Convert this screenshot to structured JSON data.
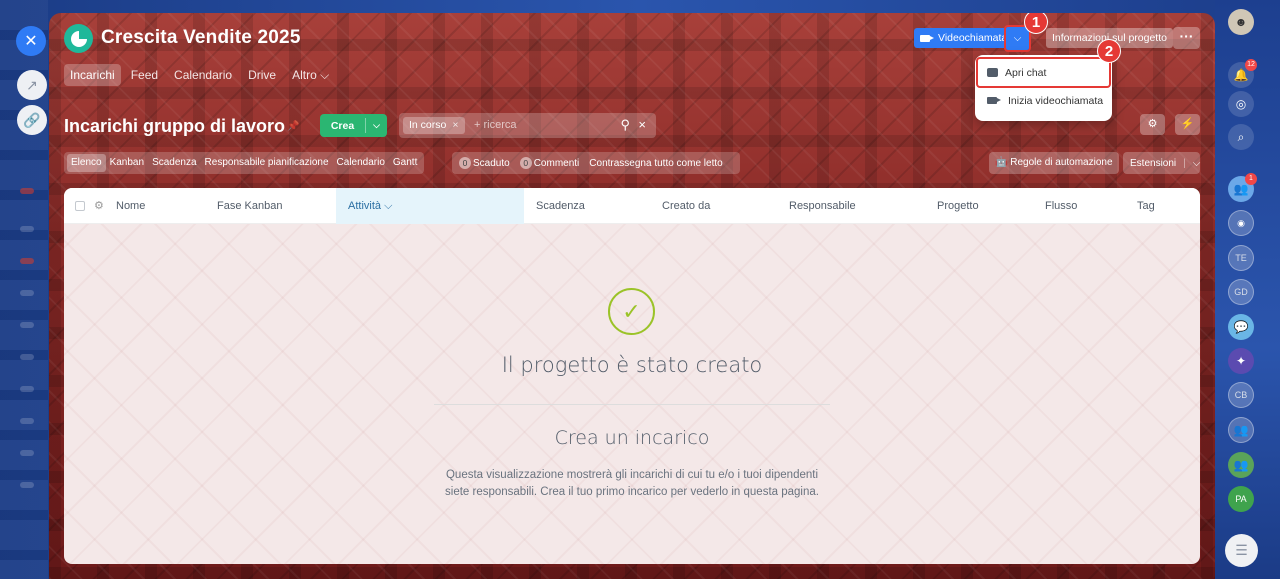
{
  "project": {
    "title": "Crescita Vendite 2025"
  },
  "topnav": {
    "tabs": [
      "Incarichi",
      "Feed",
      "Calendario",
      "Drive",
      "Altro ⌵"
    ]
  },
  "header_buttons": {
    "videocall": "Videochiamata",
    "videocall_dropdown": "⌵",
    "info": "Informazioni sul progetto",
    "more": "···"
  },
  "markers": {
    "first": "1",
    "second": "2"
  },
  "dropdown": {
    "items": [
      "Apri chat",
      "Inizia videochiamata"
    ]
  },
  "page": {
    "heading": "Incarichi gruppo di lavoro"
  },
  "toolbar": {
    "create": "Crea",
    "create_arrow": "⌵"
  },
  "search": {
    "chip": "In corso",
    "chip_close": "×",
    "placeholder": "+ ricerca",
    "search_icon": "⚲",
    "clear_icon": "×"
  },
  "subnav": {
    "tabs": [
      "Elenco",
      "Kanban",
      "Scadenza",
      "Responsabile pianificazione",
      "Calendario",
      "Gantt"
    ]
  },
  "counters": {
    "scaduto_count": "0",
    "scaduto": "Scaduto",
    "commenti_count": "0",
    "commenti": "Commenti",
    "mark_read": "Contrassegna tutto come letto"
  },
  "actions": {
    "automation": "Regole di automazione",
    "extensions": "Estensioni",
    "ext_arrow": "⌵"
  },
  "table": {
    "columns": [
      "Nome",
      "Fase Kanban",
      "Attività ⌵",
      "Scadenza",
      "Creato da",
      "Responsabile",
      "Progetto",
      "Flusso",
      "Tag"
    ]
  },
  "empty": {
    "title": "Il progetto è stato creato",
    "subtitle": "Crea un incarico",
    "description_1": "Questa visualizzazione mostrerà gli incarichi di cui tu e/o i tuoi dipendenti",
    "description_2": "siete responsabili. Crea il tuo primo incarico per vederlo in questa pagina."
  },
  "rightbar": {
    "notifications_badge": "12",
    "group_badge": "1",
    "avatars": [
      "TE",
      "GD",
      "CB",
      "PA"
    ]
  },
  "colors": {
    "accent": "#2f7bf5",
    "create": "#2bb672",
    "highlight": "#e53935",
    "success": "#9bc328"
  }
}
